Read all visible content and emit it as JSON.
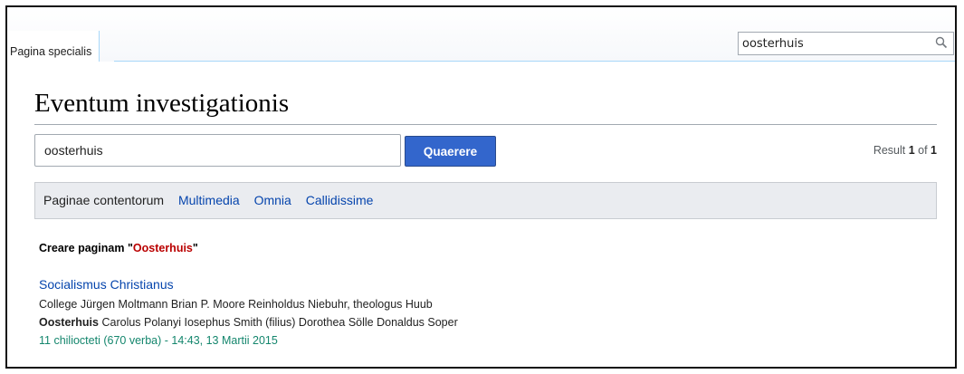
{
  "tabs": {
    "special_page": "Pagina specialis"
  },
  "top_search": {
    "value": "oosterhuis"
  },
  "page": {
    "title": "Eventum investigationis"
  },
  "search": {
    "value": "oosterhuis",
    "button_label": "Quaerere",
    "result_prefix": "Result ",
    "result_count": "1",
    "result_mid": " of ",
    "result_total": "1"
  },
  "filters": {
    "items": [
      {
        "label": "Paginae contentorum",
        "active": true
      },
      {
        "label": "Multimedia",
        "active": false
      },
      {
        "label": "Omnia",
        "active": false
      },
      {
        "label": "Callidissime",
        "active": false
      }
    ]
  },
  "create": {
    "prefix": "Creare paginam \"",
    "name": "Oosterhuis",
    "suffix": "\""
  },
  "results": [
    {
      "title": "Socialismus Christianus",
      "snippet_line1": "College Jürgen Moltmann Brian P. Moore Reinholdus Niebuhr, theologus Huub",
      "snippet_bold": "Oosterhuis",
      "snippet_line2_rest": " Carolus Polanyi Iosephus Smith (filius) Dorothea Sölle Donaldus Soper",
      "meta": "11 chiliocteti (670 verba) - 14:43, 13 Martii 2015"
    }
  ],
  "colors": {
    "link": "#0645ad",
    "red_link": "#ba0000",
    "meta_green": "#14866d",
    "button_blue": "#3366cc"
  }
}
